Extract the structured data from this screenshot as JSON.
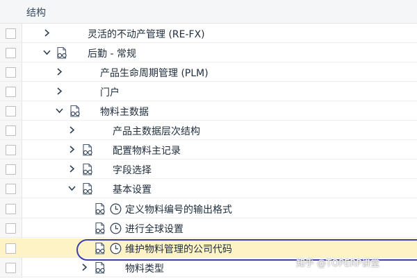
{
  "header": {
    "title": "结构"
  },
  "tree": [
    {
      "label": "灵活的不动产管理 (RE-FX)",
      "expander": "collapsed",
      "icons": []
    },
    {
      "label": "后勤 - 常规",
      "expander": "expanded",
      "icons": [
        "glasses-doc-icon"
      ]
    },
    {
      "label": "产品生命周期管理 (PLM)",
      "expander": "collapsed",
      "icons": []
    },
    {
      "label": "门户",
      "expander": "collapsed",
      "icons": []
    },
    {
      "label": "物料主数据",
      "expander": "expanded",
      "icons": [
        "glasses-doc-icon"
      ]
    },
    {
      "label": "产品主数据层次结构",
      "expander": "collapsed",
      "icons": []
    },
    {
      "label": "配置物料主记录",
      "expander": "collapsed",
      "icons": [
        "glasses-doc-icon"
      ]
    },
    {
      "label": "字段选择",
      "expander": "collapsed",
      "icons": [
        "glasses-doc-icon"
      ]
    },
    {
      "label": "基本设置",
      "expander": "expanded",
      "icons": [
        "glasses-doc-icon"
      ]
    },
    {
      "label": "定义物料编号的输出格式",
      "expander": "none",
      "icons": [
        "glasses-doc-icon",
        "clock-icon"
      ]
    },
    {
      "label": "进行全球设置",
      "expander": "none",
      "icons": [
        "glasses-doc-icon",
        "clock-icon"
      ]
    },
    {
      "label": "维护物料管理的公司代码",
      "expander": "none",
      "icons": [
        "glasses-doc-icon",
        "clock-icon"
      ],
      "selected": true
    },
    {
      "label": "物料类型",
      "expander": "collapsed",
      "icons": [
        "glasses-doc-icon"
      ]
    }
  ],
  "watermark": "知乎 @TOPERP讲堂",
  "colors": {
    "selected_row": "#fdf3c4",
    "highlight_ring": "#3a3fb0",
    "chevron": "#2f3e52"
  }
}
